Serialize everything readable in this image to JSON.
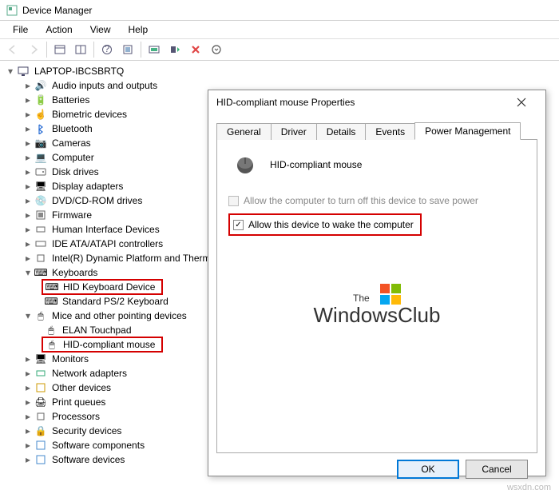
{
  "window": {
    "title": "Device Manager"
  },
  "menu": {
    "file": "File",
    "action": "Action",
    "view": "View",
    "help": "Help"
  },
  "root": "LAPTOP-IBCSBRTQ",
  "cats": {
    "audio": "Audio inputs and outputs",
    "batt": "Batteries",
    "bio": "Biometric devices",
    "bt": "Bluetooth",
    "cam": "Cameras",
    "comp": "Computer",
    "disk": "Disk drives",
    "disp": "Display adapters",
    "dvd": "DVD/CD-ROM drives",
    "fw": "Firmware",
    "hid": "Human Interface Devices",
    "ide": "IDE ATA/ATAPI controllers",
    "intel": "Intel(R) Dynamic Platform and Thermal Framework",
    "kb": "Keyboards",
    "kb1": "HID Keyboard Device",
    "kb2": "Standard PS/2 Keyboard",
    "mice": "Mice and other pointing devices",
    "m1": "ELAN Touchpad",
    "m2": "HID-compliant mouse",
    "mon": "Monitors",
    "net": "Network adapters",
    "other": "Other devices",
    "pq": "Print queues",
    "proc": "Processors",
    "sec": "Security devices",
    "swc": "Software components",
    "swd": "Software devices"
  },
  "dialog": {
    "title": "HID-compliant mouse Properties",
    "tabs": {
      "general": "General",
      "driver": "Driver",
      "details": "Details",
      "events": "Events",
      "power": "Power Management"
    },
    "device": "HID-compliant mouse",
    "opt1": "Allow the computer to turn off this device to save power",
    "opt2": "Allow this device to wake the computer",
    "ok": "OK",
    "cancel": "Cancel"
  },
  "logo": {
    "l1": "The",
    "l2": "WindowsClub"
  },
  "credit": "wsxdn.com"
}
